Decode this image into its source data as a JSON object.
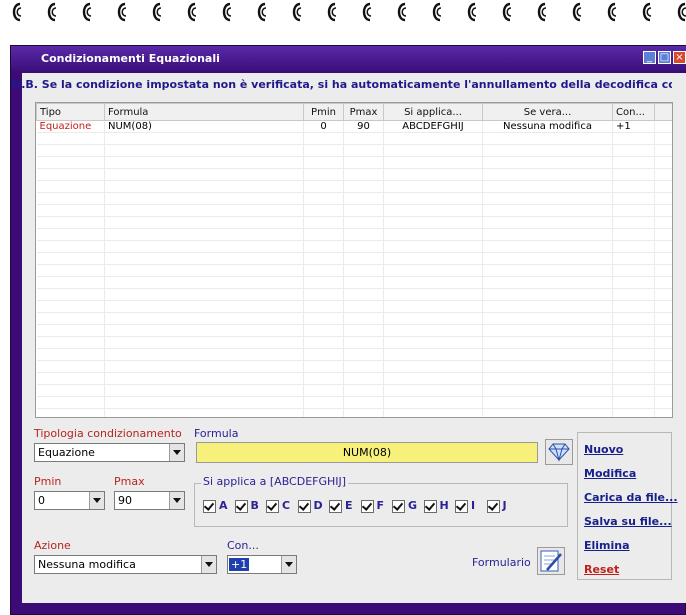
{
  "window": {
    "title": "Condizionamenti Equazionali"
  },
  "note": "N.B. Se la condizione impostata non è verificata, si ha automaticamente l'annullamento della decodifica corrente.",
  "table": {
    "headers": [
      "Tipo",
      "Formula",
      "Pmin",
      "Pmax",
      "Si applica...",
      "Se vera...",
      "Con..."
    ],
    "rows": [
      {
        "tipo": "Equazione",
        "formula": "NUM(08)",
        "pmin": "0",
        "pmax": "90",
        "si_applica": "ABCDEFGHIJ",
        "se_vera": "Nessuna modifica",
        "con": "+1"
      }
    ]
  },
  "form": {
    "tipologia_label": "Tipologia condizionamento",
    "tipologia_value": "Equazione",
    "formula_label": "Formula",
    "formula_value": "NUM(08)",
    "pmin_label": "Pmin",
    "pmin_value": "0",
    "pmax_label": "Pmax",
    "pmax_value": "90",
    "si_applica_label": "Si applica a [ABCDEFGHIJ]",
    "letters": [
      "A",
      "B",
      "C",
      "D",
      "E",
      "F",
      "G",
      "H",
      "I",
      "J"
    ],
    "azione_label": "Azione",
    "azione_value": "Nessuna modifica",
    "con_label": "Con...",
    "con_value": "+1",
    "formulario_label": "Formulario"
  },
  "actions": {
    "nuovo": "Nuovo",
    "modifica": "Modifica",
    "carica": "Carica da file...",
    "salva": "Salva su file...",
    "elimina": "Elimina",
    "reset": "Reset"
  },
  "colors": {
    "titlebar": "#3d0b78",
    "label_blue": "#2b2296",
    "tipo_red": "#c0201a",
    "formula_bg": "#f7f07a"
  }
}
